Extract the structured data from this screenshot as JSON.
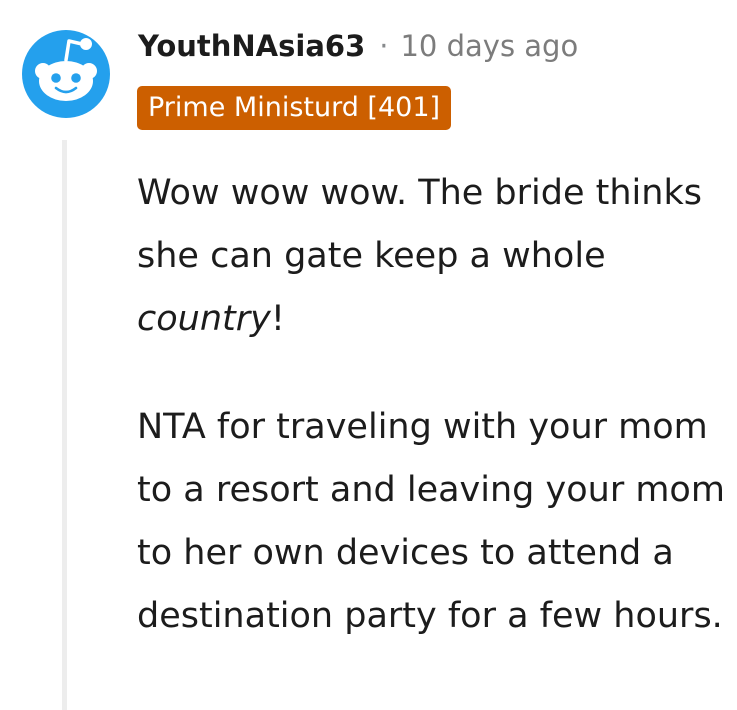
{
  "comment": {
    "author": {
      "username": "YouthNAsia63",
      "avatar_icon": "reddit-snoo-icon",
      "avatar_bg": "#24a0ed"
    },
    "separator": "·",
    "timestamp": "10 days ago",
    "flair": {
      "text": "Prime Ministurd [401]",
      "bg_color": "#cc5f00",
      "text_color": "#ffffff"
    },
    "body": {
      "paragraph1": {
        "before": "Wow wow wow. The bride thinks she can gate keep a whole ",
        "emphasis": "country",
        "after": "!"
      },
      "paragraph2": "NTA for traveling with your mom to a resort and leaving your mom to her own devices to attend a destination party for a few hours."
    }
  }
}
